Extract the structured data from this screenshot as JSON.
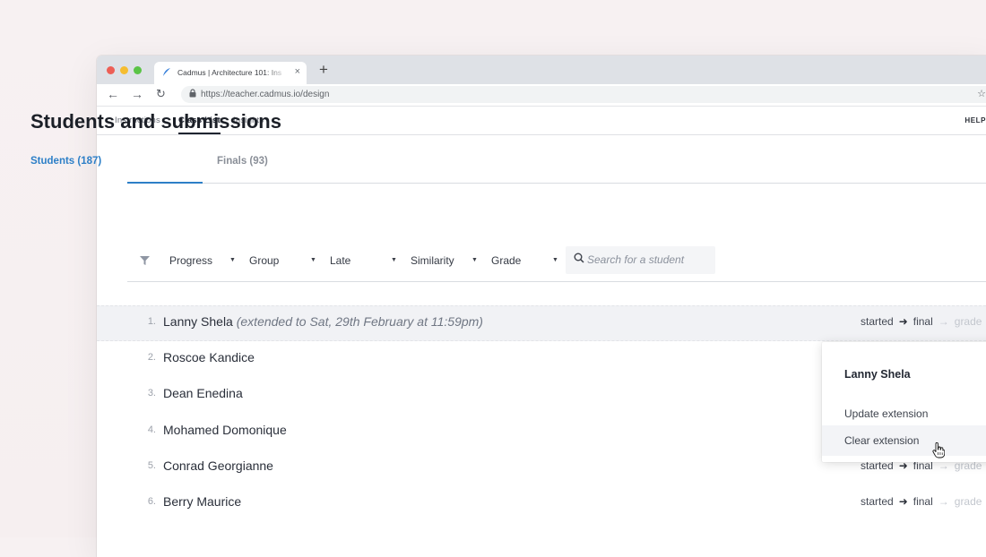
{
  "browser": {
    "tab_title": "Cadmus | Architecture 101: Ins",
    "tab_close": "×",
    "new_tab": "+",
    "url": "https://teacher.cadmus.io/design",
    "icons": {
      "back": "←",
      "forward": "→",
      "reload": "↻",
      "lock": "🔒",
      "star": "☆"
    }
  },
  "app_nav": {
    "items": [
      "Instructions",
      "Class List",
      "Insights"
    ],
    "active": "Class List",
    "help": "HELP +"
  },
  "page": {
    "title": "Students and submissions",
    "tabs": [
      {
        "label": "Students (187)",
        "active": true
      },
      {
        "label": "Finals (93)",
        "active": false
      }
    ]
  },
  "filters": {
    "items": [
      "Progress",
      "Group",
      "Late",
      "Similarity",
      "Grade"
    ],
    "caret": "▼",
    "search_placeholder": "Search for a student"
  },
  "students": [
    {
      "num": "1.",
      "name": "Lanny Shela",
      "extension": "(extended to Sat, 29th February at 11:59pm)",
      "status": {
        "a": "started",
        "b": "final",
        "c": "grade"
      }
    },
    {
      "num": "2.",
      "name": "Roscoe Kandice"
    },
    {
      "num": "3.",
      "name": "Dean Enedina"
    },
    {
      "num": "4.",
      "name": "Mohamed Domonique"
    },
    {
      "num": "5.",
      "name": "Conrad Georgianne",
      "status": {
        "a": "started",
        "b": "final",
        "c": "grade"
      }
    },
    {
      "num": "6.",
      "name": "Berry Maurice",
      "status": {
        "a": "started",
        "b": "final",
        "c": "grade"
      }
    }
  ],
  "arrows": {
    "strong": "➜",
    "dim": "→"
  },
  "popover": {
    "title": "Lanny Shela",
    "items": [
      "Update extension",
      "Clear extension"
    ]
  },
  "colors": {
    "accent": "#2d7fc7",
    "highlight_row": "#f1f2f5"
  }
}
